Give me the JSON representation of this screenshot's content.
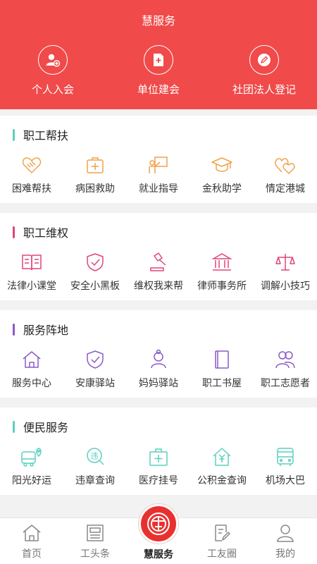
{
  "header": {
    "title": "慧服务",
    "actions": [
      {
        "label": "个人入会",
        "icon": "person-add-icon"
      },
      {
        "label": "单位建会",
        "icon": "document-add-icon"
      },
      {
        "label": "社团法人登记",
        "icon": "pencil-icon"
      }
    ]
  },
  "sections": [
    {
      "title": "职工帮扶",
      "accent": "#5ccfc0",
      "items": [
        {
          "label": "困难帮扶",
          "icon": "handshake-icon"
        },
        {
          "label": "病困救助",
          "icon": "first-aid-kit-icon"
        },
        {
          "label": "就业指导",
          "icon": "teacher-board-icon"
        },
        {
          "label": "金秋助学",
          "icon": "graduation-cap-icon"
        },
        {
          "label": "情定港城",
          "icon": "hearts-icon"
        }
      ]
    },
    {
      "title": "职工维权",
      "accent": "#e0457b",
      "items": [
        {
          "label": "法律小课堂",
          "icon": "open-book-icon"
        },
        {
          "label": "安全小黑板",
          "icon": "shield-check-icon"
        },
        {
          "label": "维权我来帮",
          "icon": "gavel-icon"
        },
        {
          "label": "律师事务所",
          "icon": "law-building-icon"
        },
        {
          "label": "调解小技巧",
          "icon": "balance-scale-icon"
        }
      ]
    },
    {
      "title": "服务阵地",
      "accent": "#8a5bc8",
      "items": [
        {
          "label": "服务中心",
          "icon": "home-icon"
        },
        {
          "label": "安康驿站",
          "icon": "shield-check-icon"
        },
        {
          "label": "妈妈驿站",
          "icon": "mother-icon"
        },
        {
          "label": "职工书屋",
          "icon": "book-icon"
        },
        {
          "label": "职工志愿者",
          "icon": "people-icon"
        }
      ]
    },
    {
      "title": "便民服务",
      "accent": "#5ccfc0",
      "items": [
        {
          "label": "阳光好运",
          "icon": "bus-location-icon"
        },
        {
          "label": "违章查询",
          "icon": "violation-search-icon"
        },
        {
          "label": "医疗挂号",
          "icon": "medical-kit-icon"
        },
        {
          "label": "公积金查询",
          "icon": "yuan-house-icon"
        },
        {
          "label": "机场大巴",
          "icon": "bus-icon"
        }
      ]
    }
  ],
  "tabbar": [
    {
      "label": "首页",
      "icon": "home-icon"
    },
    {
      "label": "工头条",
      "icon": "news-icon"
    },
    {
      "label": "慧服务",
      "icon": "union-logo-icon"
    },
    {
      "label": "工友圈",
      "icon": "edit-note-icon"
    },
    {
      "label": "我的",
      "icon": "user-icon"
    }
  ],
  "colors": {
    "header_bg": "#f04a4a",
    "icon_orange": "#f0a24a",
    "icon_pink": "#e0457b",
    "icon_purple": "#8a5bc8",
    "icon_teal": "#5ccfc0",
    "tab_gray": "#888888",
    "logo_red": "#e8312f"
  }
}
